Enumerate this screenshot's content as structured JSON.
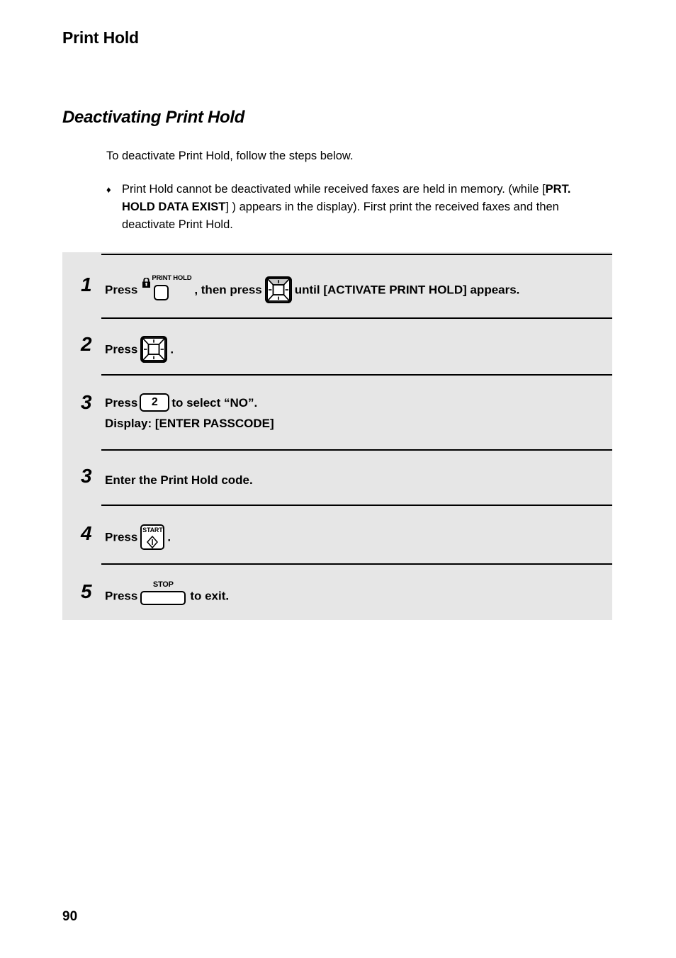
{
  "document": {
    "running_head": "Print Hold",
    "section_heading": "Deactivating Print Hold",
    "intro": "To deactivate Print Hold, follow the steps below.",
    "note": {
      "bullet_glyph": "♦",
      "text_before_bold": "Print Hold cannot be deactivated while received faxes are held in memory. (while [",
      "bold_text": "PRT. HOLD DATA EXIST",
      "text_after_bold": "] ) appears in the display). First print the received faxes and then deactivate Print Hold."
    },
    "page_number": "90"
  },
  "keys": {
    "print_hold": {
      "label": "PRINT HOLD",
      "icon": "lock-icon"
    },
    "navigation": {
      "icon": "four-way-navigation-key-icon"
    },
    "numeric_two": {
      "label": "2"
    },
    "start": {
      "label": "START",
      "icon": "start-diamond-icon"
    },
    "stop": {
      "label": "STOP"
    }
  },
  "steps": [
    {
      "number": "1",
      "text_1": "Press",
      "key_1": "print-hold-key",
      "text_2": ", then press",
      "key_2": "navigation-key",
      "text_3": "until [ACTIVATE PRINT HOLD] appears."
    },
    {
      "number": "2",
      "text_1": "Press",
      "key_1": "navigation-key",
      "text_2": "."
    },
    {
      "number": "3",
      "text_1": "Press",
      "key_1": "numeric-key-2",
      "text_2": "to select “NO”.",
      "line_2": "Display: [ENTER PASSCODE]"
    },
    {
      "number": "3",
      "text_1": "Enter the Print Hold code."
    },
    {
      "number": "4",
      "text_1": "Press",
      "key_1": "start-key",
      "text_2": "."
    },
    {
      "number": "5",
      "text_1": "Press",
      "key_1": "stop-key",
      "text_2": "to exit."
    }
  ],
  "colors": {
    "panel_background": "#e6e6e6",
    "text": "#000000",
    "page_background": "#ffffff"
  }
}
